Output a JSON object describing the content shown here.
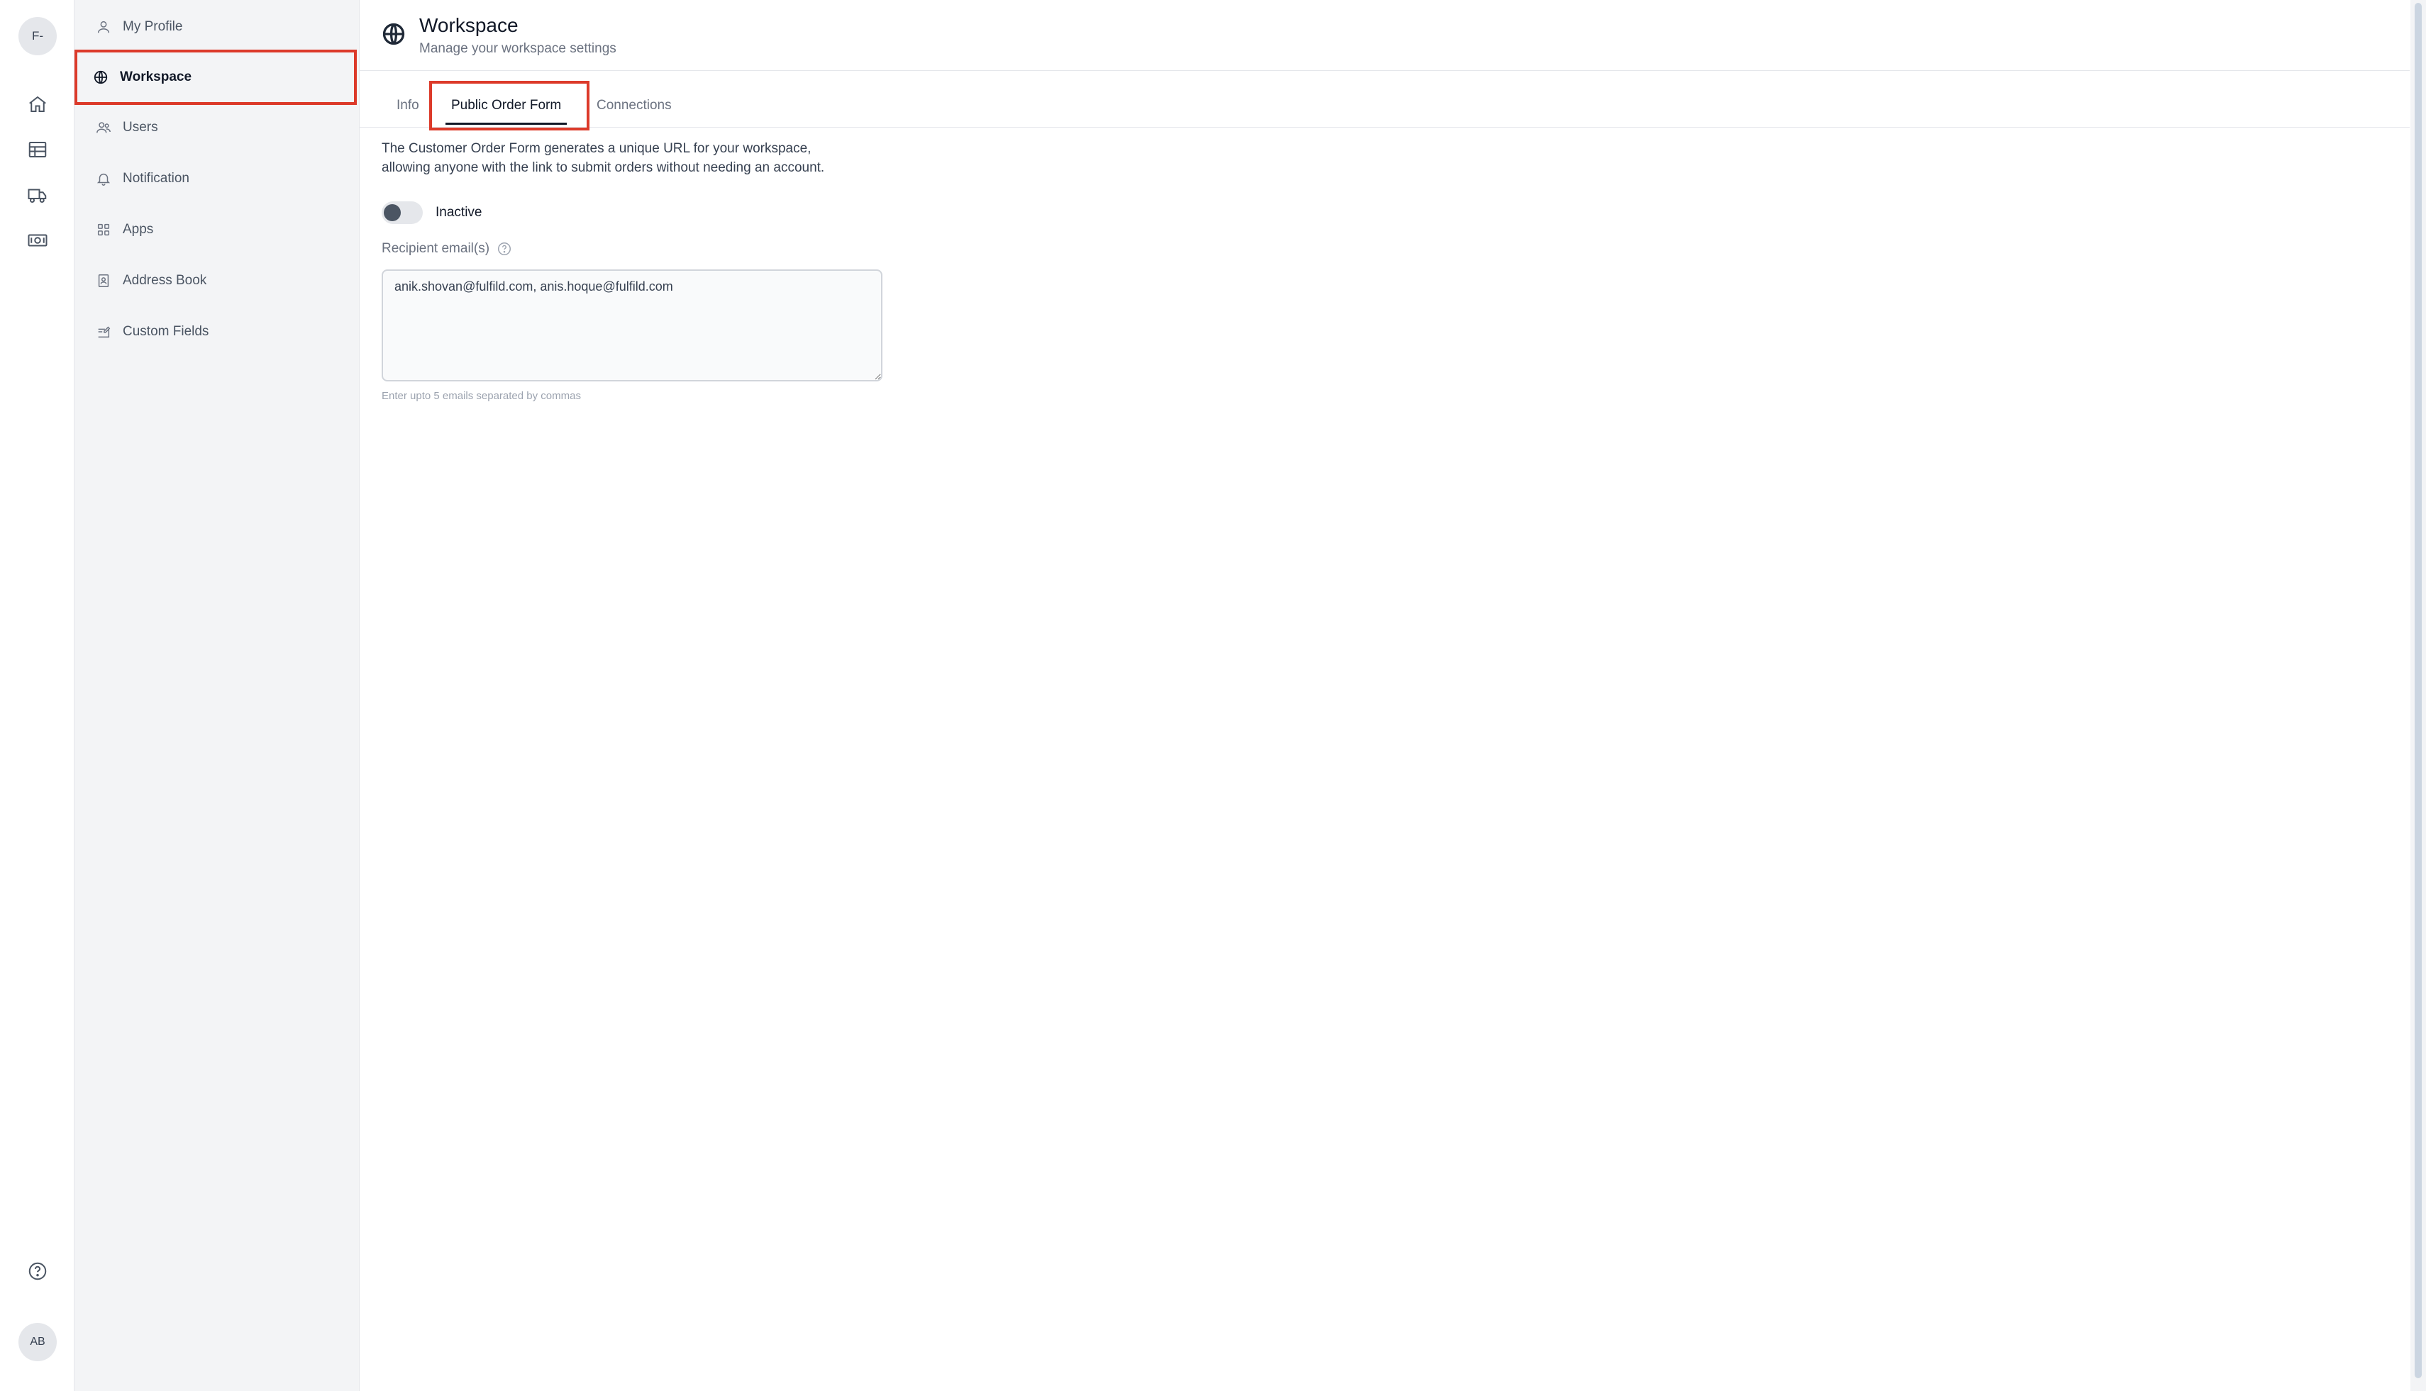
{
  "rail": {
    "workspace_avatar": "F-",
    "user_avatar": "AB"
  },
  "sidebar": {
    "items": [
      {
        "label": "My Profile",
        "icon": "user-icon"
      },
      {
        "label": "Workspace",
        "icon": "globe-icon"
      },
      {
        "label": "Users",
        "icon": "users-icon"
      },
      {
        "label": "Notification",
        "icon": "bell-icon"
      },
      {
        "label": "Apps",
        "icon": "apps-grid-icon"
      },
      {
        "label": "Address Book",
        "icon": "address-book-icon"
      },
      {
        "label": "Custom Fields",
        "icon": "edit-fields-icon"
      }
    ],
    "active": "Workspace"
  },
  "header": {
    "title": "Workspace",
    "subtitle": "Manage your workspace settings"
  },
  "tabs": [
    {
      "label": "Info"
    },
    {
      "label": "Public Order Form"
    },
    {
      "label": "Connections"
    }
  ],
  "active_tab": "Public Order Form",
  "form": {
    "description_line1": "The Customer Order Form generates a unique URL for your workspace,",
    "description_line2": "allowing anyone with the link to submit orders without needing an account.",
    "toggle_label": "Inactive",
    "toggle_on": false,
    "recipient_label": "Recipient email(s)",
    "recipient_value": "anik.shovan@fulfild.com, anis.hoque@fulfild.com",
    "helper_text": "Enter upto 5 emails separated by commas"
  },
  "colors": {
    "highlight": "#dc3a2a",
    "sidebar_bg": "#f3f4f6"
  }
}
